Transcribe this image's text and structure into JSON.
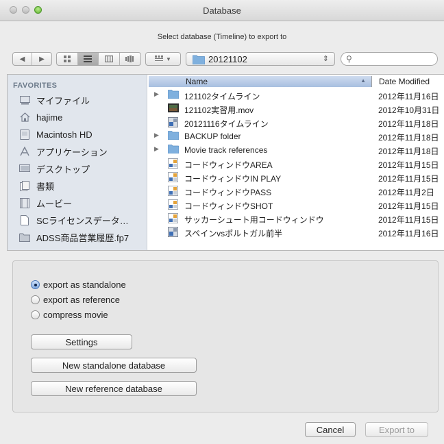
{
  "window": {
    "title": "Database"
  },
  "prompt": "Select database (Timeline) to export to",
  "toolbar": {
    "nav_back": "◀",
    "nav_forward": "▶",
    "location": "20121102",
    "location_chevron": "⇕",
    "search_placeholder": ""
  },
  "sidebar": {
    "heading": "FAVORITES",
    "items": [
      {
        "label": "マイファイル",
        "icon": "all-my-files-icon"
      },
      {
        "label": "hajime",
        "icon": "home-icon"
      },
      {
        "label": "Macintosh HD",
        "icon": "hard-drive-icon"
      },
      {
        "label": "アプリケーション",
        "icon": "applications-icon"
      },
      {
        "label": "デスクトップ",
        "icon": "desktop-icon"
      },
      {
        "label": "書類",
        "icon": "documents-icon"
      },
      {
        "label": "ムービー",
        "icon": "movies-icon"
      },
      {
        "label": "SCライセンスデータ…",
        "icon": "document-icon"
      },
      {
        "label": "ADSS商品営業履歴.fp7",
        "icon": "folder-icon"
      }
    ]
  },
  "filelist": {
    "columns": {
      "name": "Name",
      "date": "Date Modified"
    },
    "rows": [
      {
        "name": "121102タイムライン",
        "date": "2012年11月16日",
        "kind": "folder",
        "expandable": true
      },
      {
        "name": "121102実習用.mov",
        "date": "2012年10月31日",
        "kind": "movie",
        "expandable": false
      },
      {
        "name": "20121116タイムライン",
        "date": "2012年11月18日",
        "kind": "database",
        "expandable": false
      },
      {
        "name": "BACKUP folder",
        "date": "2012年11月18日",
        "kind": "folder",
        "expandable": true
      },
      {
        "name": "Movie track references",
        "date": "2012年11月18日",
        "kind": "folder",
        "expandable": true
      },
      {
        "name": "コードウィンドウAREA",
        "date": "2012年11月15日",
        "kind": "codewindow",
        "expandable": false
      },
      {
        "name": "コードウィンドウIN PLAY",
        "date": "2012年11月15日",
        "kind": "codewindow",
        "expandable": false
      },
      {
        "name": "コードウィンドウPASS",
        "date": "2012年11月2日",
        "kind": "codewindow",
        "expandable": false
      },
      {
        "name": "コードウィンドウSHOT",
        "date": "2012年11月15日",
        "kind": "codewindow",
        "expandable": false
      },
      {
        "name": "サッカーシュート用コードウィンドウ",
        "date": "2012年11月15日",
        "kind": "codewindow",
        "expandable": false
      },
      {
        "name": "スペインvsポルトガル前半",
        "date": "2012年11月16日",
        "kind": "database",
        "expandable": false
      }
    ]
  },
  "options": {
    "radios": [
      {
        "label": "export as standalone",
        "selected": true
      },
      {
        "label": "export as reference",
        "selected": false
      },
      {
        "label": "compress movie",
        "selected": false
      }
    ],
    "settings_label": "Settings",
    "new_standalone_label": "New standalone database",
    "new_reference_label": "New reference database"
  },
  "footer": {
    "cancel_label": "Cancel",
    "export_label": "Export to"
  },
  "colors": {
    "sidebar_bg": "#e1e6ed",
    "header_selected": "#b9cbe6",
    "folder": "#7fb0de",
    "radio_selected": "#7ea8e0"
  }
}
